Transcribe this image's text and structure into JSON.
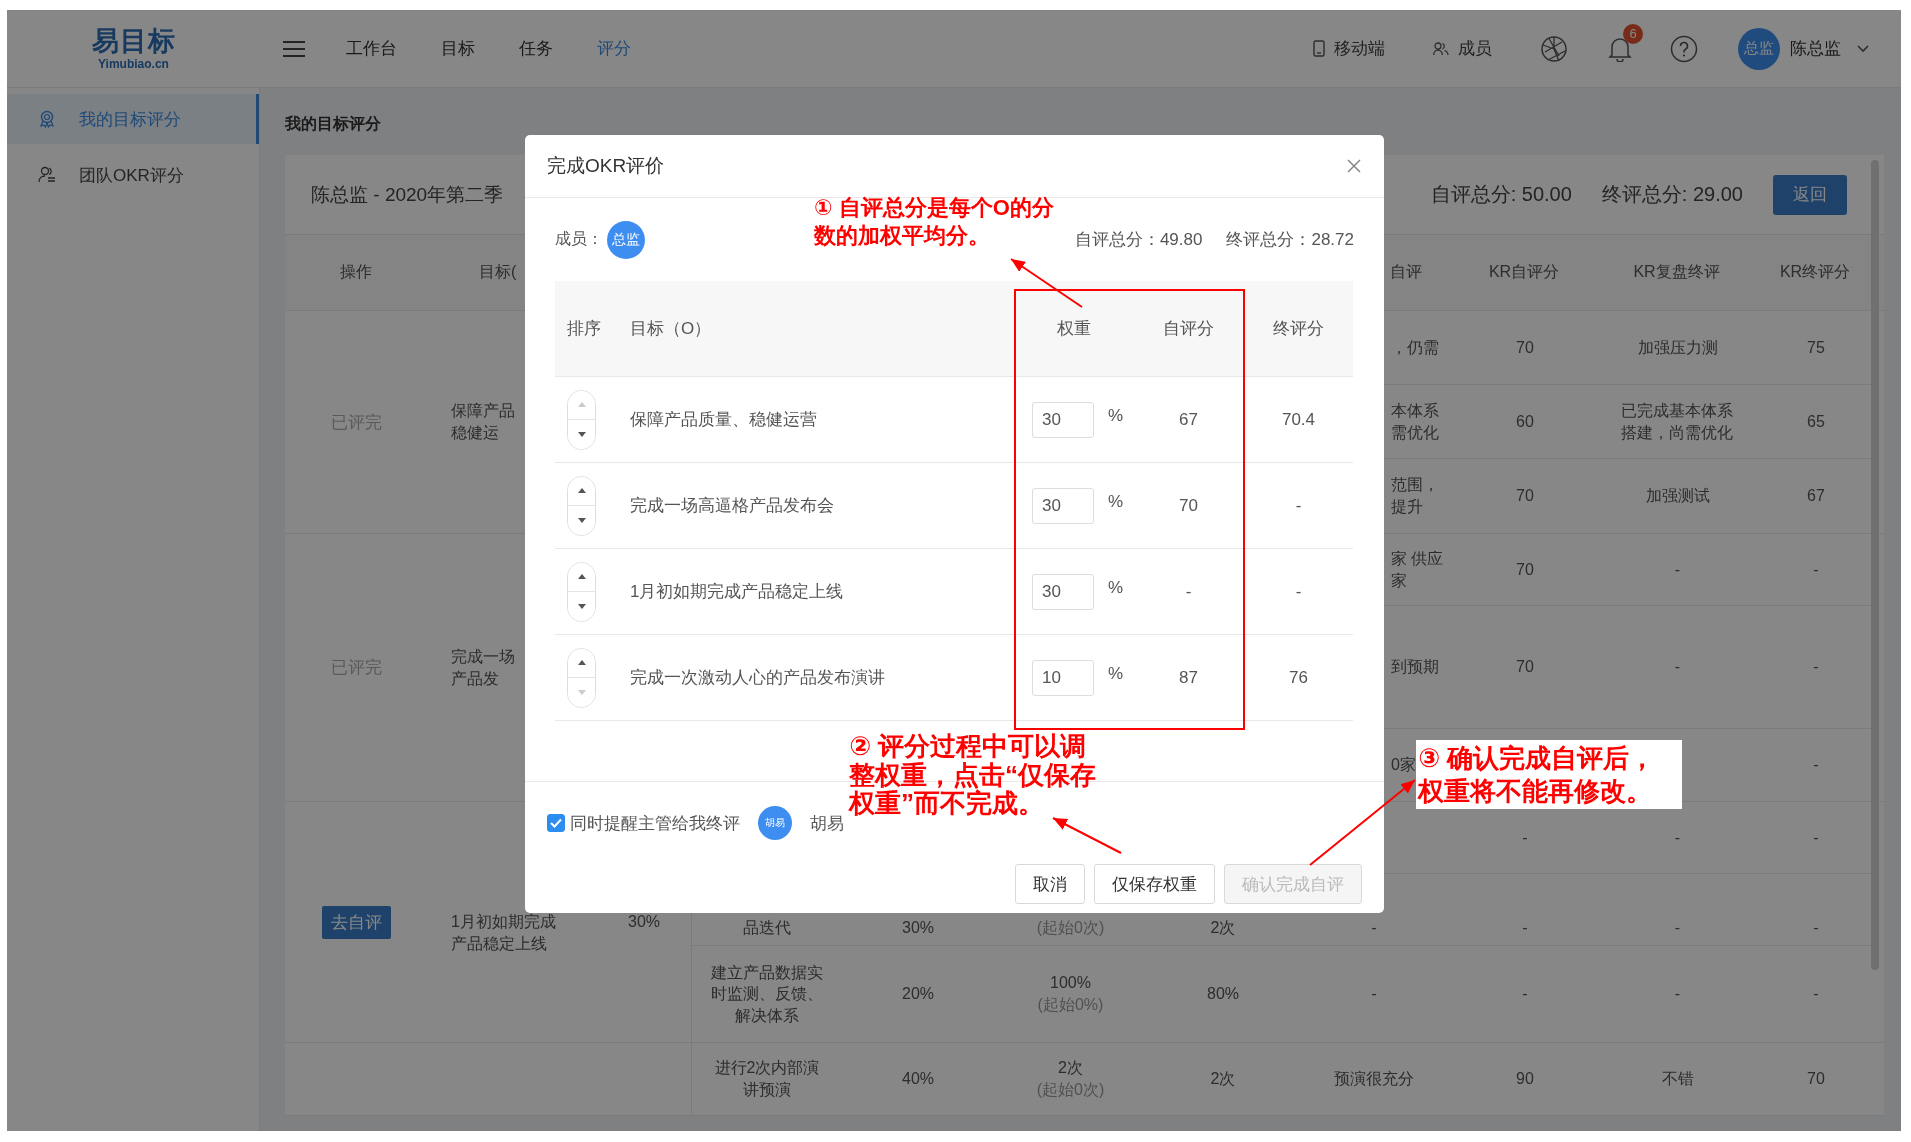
{
  "topbar": {
    "logo": "易目标",
    "logo_sub": "Yimubiao.cn",
    "nav": [
      {
        "label": "工作台",
        "selected": false
      },
      {
        "label": "目标",
        "selected": false
      },
      {
        "label": "任务",
        "selected": false
      },
      {
        "label": "评分",
        "selected": true
      }
    ],
    "mobile": "移动端",
    "members": "成员",
    "notifications": "6",
    "user_avatar": "总监",
    "user_name": "陈总监"
  },
  "sidebar": {
    "items": [
      {
        "label": "我的目标评分",
        "selected": true,
        "kind": "medal"
      },
      {
        "label": "团队OKR评分",
        "selected": false,
        "kind": "team"
      }
    ]
  },
  "page_title": "我的目标评分",
  "card": {
    "heading": "陈总监 - 2020年第二季",
    "self_total": "自评总分: 50.00",
    "final_total": "终评总分: 29.00",
    "back_button": "返回"
  },
  "table": {
    "columns": {
      "column_1": "操作",
      "column_2": "目标(",
      "column_8": "自评",
      "column_9": "KR自评分",
      "column_10": "KR复盘终评",
      "column_11": "KR终评分"
    },
    "groups": [
      {
        "action": {
          "kind": "status",
          "text": "已评完"
        },
        "objective": "保障产品稳健运",
        "krs": [
          {
            "column_8": "，仍需",
            "column_9": "70",
            "column_10": "加强压力测",
            "column_11": "75"
          },
          {
            "column_8": "本体系需优化",
            "column_9": "60",
            "column_10": "已完成基本体系搭建，尚需优化",
            "column_11": "65"
          },
          {
            "column_8": "范围，提升",
            "column_9": "70",
            "column_10": "加强测试",
            "column_11": "67"
          }
        ]
      },
      {
        "action": {
          "kind": "status",
          "text": "已评完"
        },
        "objective": "完成一场产品发",
        "krs": [
          {
            "column_8": "家 供应家",
            "column_9": "70",
            "column_10": "-",
            "column_11": "-"
          },
          {
            "column_8": "到预期",
            "column_9": "70",
            "column_10": "-",
            "column_11": "-"
          },
          {
            "column_8": "0家",
            "column_11": "-"
          }
        ]
      },
      {
        "action": {
          "kind": "button",
          "text": "去自评"
        },
        "objective": "1月初如期完成产品稳定上线",
        "weight": "30%",
        "krs": [
          {
            "column_9": "-",
            "column_10": "-",
            "column_11": "-"
          },
          {
            "column_4": "品迭代",
            "column_5": "30%",
            "column_6": {
              "note": "(起始0次)"
            },
            "column_7": "2次",
            "column_8": "-",
            "column_9": "-",
            "column_10": "-",
            "column_11": "-"
          },
          {
            "column_4": "建立产品数据实时监测、反馈、解决体系",
            "column_5": "20%",
            "column_6": {
              "value": "100%",
              "note": "(起始0%)"
            },
            "column_7": "80%",
            "column_8": "-",
            "column_9": "-",
            "column_10": "-",
            "column_11": "-"
          }
        ]
      },
      {
        "krs": [
          {
            "column_4": "进行2次内部演讲预演",
            "column_5": "40%",
            "column_6": {
              "value": "2次",
              "note": "(起始0次)"
            },
            "column_7": "2次",
            "column_8": "预演很充分",
            "column_9": "90",
            "column_10": "不错",
            "column_11": "70"
          }
        ]
      }
    ]
  },
  "dialog": {
    "title": "完成OKR评价",
    "member_label": "成员：",
    "member_avatar": "总监",
    "self_total": "自评总分：49.80",
    "final_total": "终评总分：28.72",
    "columns": {
      "order": "排序",
      "objective": "目标（O）",
      "weight": "权重",
      "self_score": "自评分",
      "final_score": "终评分"
    },
    "rows": [
      {
        "objective": "保障产品质量、稳健运营",
        "weight": "30",
        "unit": "%",
        "self_score": "67",
        "final_score": "70.4",
        "up_disabled": true,
        "down_disabled": false
      },
      {
        "objective": "完成一场高逼格产品发布会",
        "weight": "30",
        "unit": "%",
        "self_score": "70",
        "final_score": "-",
        "up_disabled": false,
        "down_disabled": false
      },
      {
        "objective": "1月初如期完成产品稳定上线",
        "weight": "30",
        "unit": "%",
        "self_score": "-",
        "final_score": "-",
        "up_disabled": false,
        "down_disabled": false
      },
      {
        "objective": "完成一次激动人心的产品发布演讲",
        "weight": "10",
        "unit": "%",
        "self_score": "87",
        "final_score": "76",
        "up_disabled": false,
        "down_disabled": true
      }
    ],
    "remind": {
      "label": "同时提醒主管给我终评",
      "checked": true,
      "avatar": "胡易",
      "name": "胡易"
    },
    "buttons": [
      {
        "label": "取消",
        "disabled": false
      },
      {
        "label": "仅保存权重",
        "disabled": false
      },
      {
        "label": "确认完成自评",
        "disabled": true
      }
    ]
  },
  "annotations": [
    {
      "text": "① 自评总分是每个O的分数的加权平均分。"
    },
    {
      "text": "② 评分过程中可以调整权重，点击“仅保存权重”而不完成。"
    },
    {
      "text": "③ 确认完成自评后，权重将不能再修改。"
    }
  ]
}
